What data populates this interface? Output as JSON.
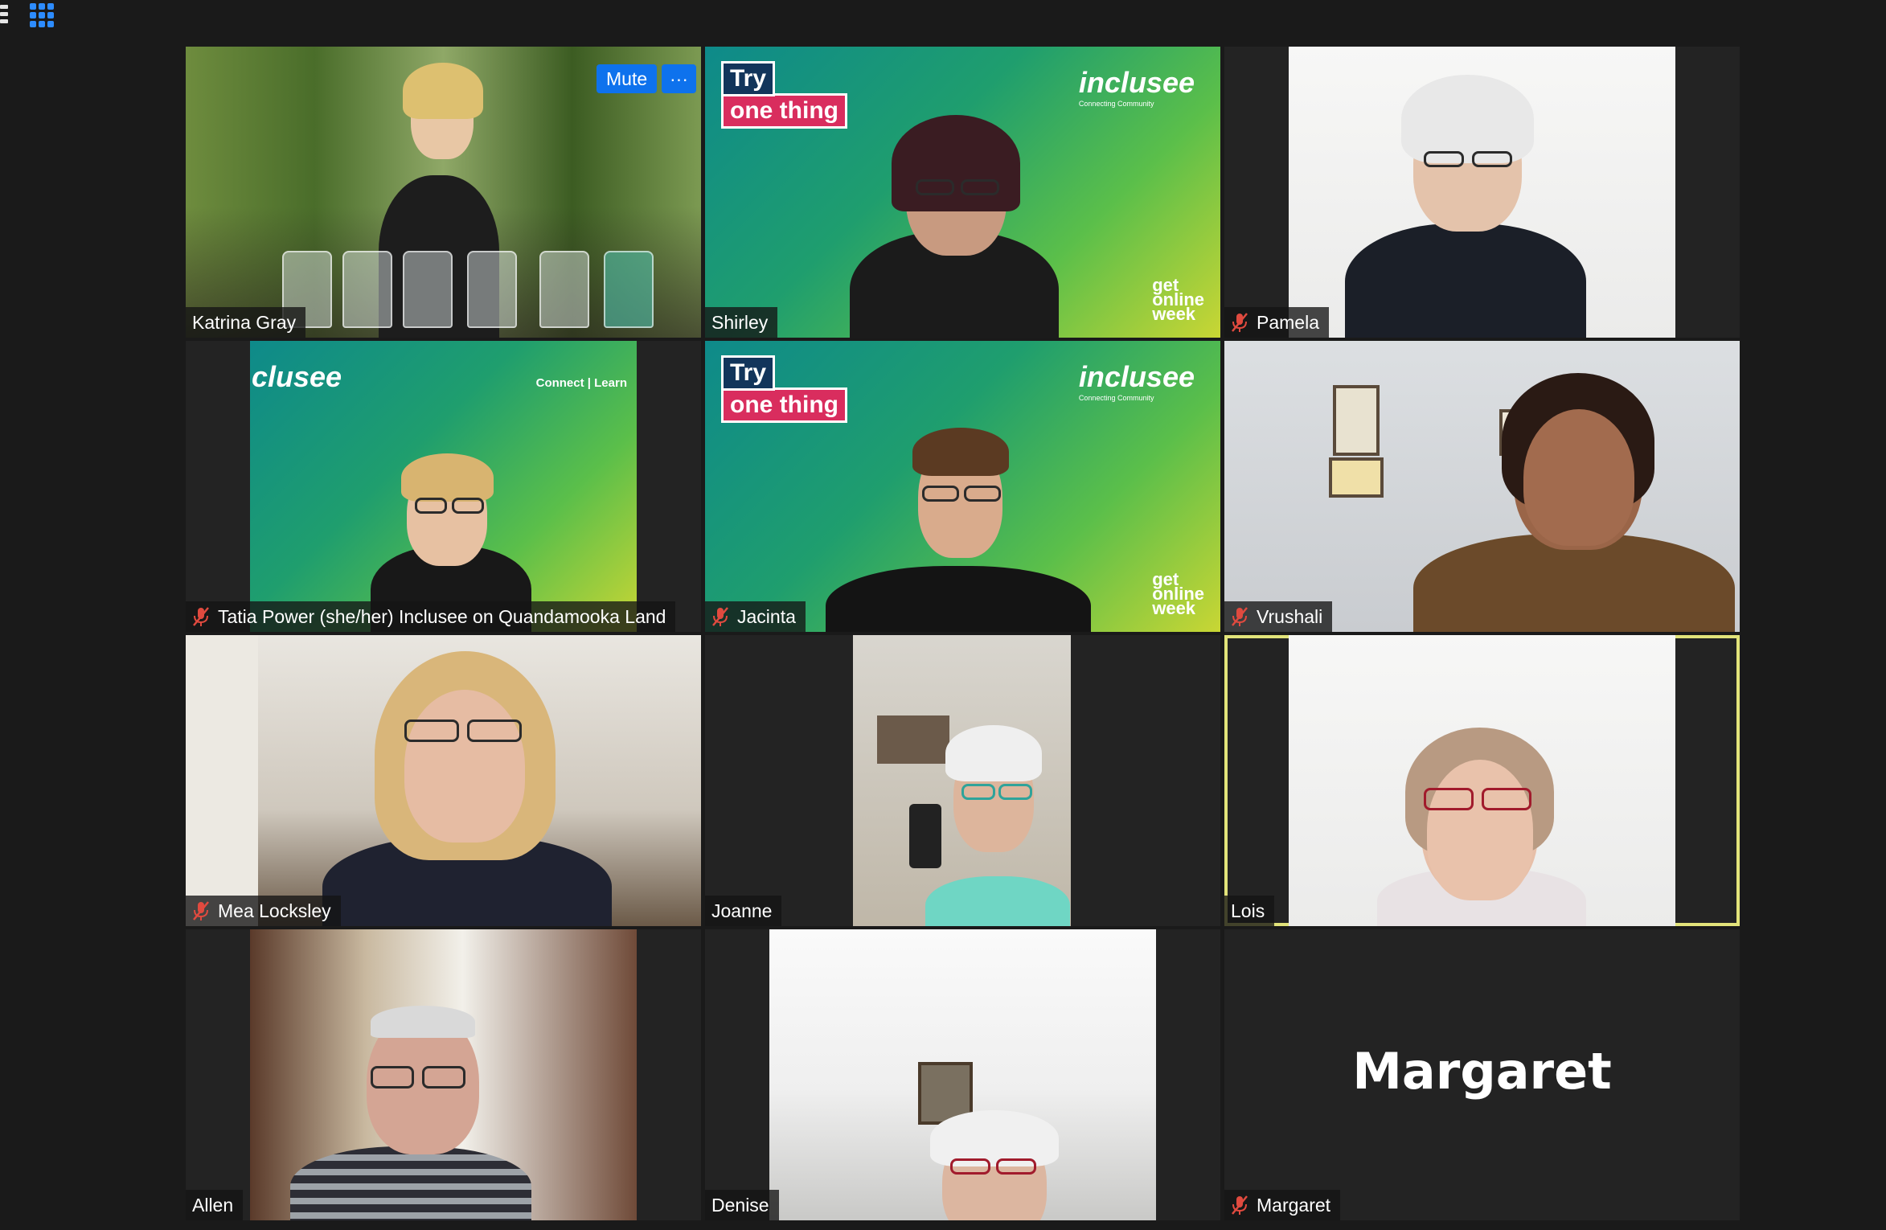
{
  "toolbar": {
    "menu_icon": "hamburger-menu-icon",
    "gallery_icon": "gallery-view-icon",
    "gallery_color": "#2d8cff"
  },
  "tile_controls": {
    "mute_label": "Mute",
    "more_label": "···"
  },
  "branding": {
    "try": "Try",
    "one_thing": "one thing",
    "logo": "inclusee",
    "logo_sub": "Connecting Community",
    "logo_partial": "clusee",
    "tagline": "Connect | Learn",
    "gow_get": "get",
    "gow_online": "online",
    "gow_week": "week"
  },
  "participants": [
    {
      "name": "Katrina Gray",
      "muted": false
    },
    {
      "name": "Shirley",
      "muted": false
    },
    {
      "name": "Pamela",
      "muted": true
    },
    {
      "name": "Tatia Power (she/her) Inclusee on Quandamooka Land",
      "muted": true
    },
    {
      "name": "Jacinta",
      "muted": true
    },
    {
      "name": "Vrushali",
      "muted": true
    },
    {
      "name": "Mea Locksley",
      "muted": true
    },
    {
      "name": "Joanne",
      "muted": false
    },
    {
      "name": "Lois",
      "muted": false,
      "active_speaker": true
    },
    {
      "name": "Allen",
      "muted": false
    },
    {
      "name": "Denise",
      "muted": false
    },
    {
      "name": "Margaret",
      "muted": true,
      "video_off": true
    }
  ],
  "colors": {
    "background": "#1a1a1a",
    "active_speaker_border": "#e2e37a",
    "button_blue": "#0e72ed",
    "muted_mic": "#e04a3f"
  }
}
